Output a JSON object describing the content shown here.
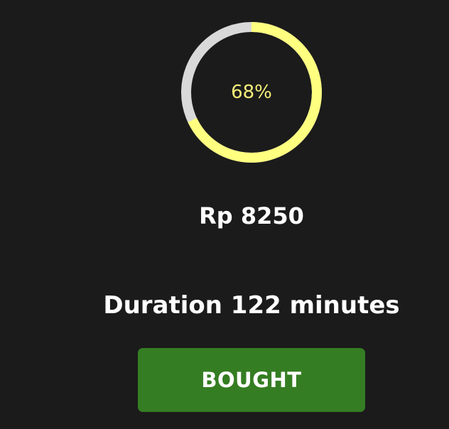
{
  "progress": {
    "value": 0.68,
    "label": "68%",
    "track_color": "#d9d9d9",
    "fill_color": "#ffff80",
    "text_color": "#f6ee7a"
  },
  "price": {
    "text": "Rp 8250"
  },
  "duration": {
    "text": "Duration 122 minutes"
  },
  "button": {
    "label": "BOUGHT",
    "color": "#357d23"
  }
}
